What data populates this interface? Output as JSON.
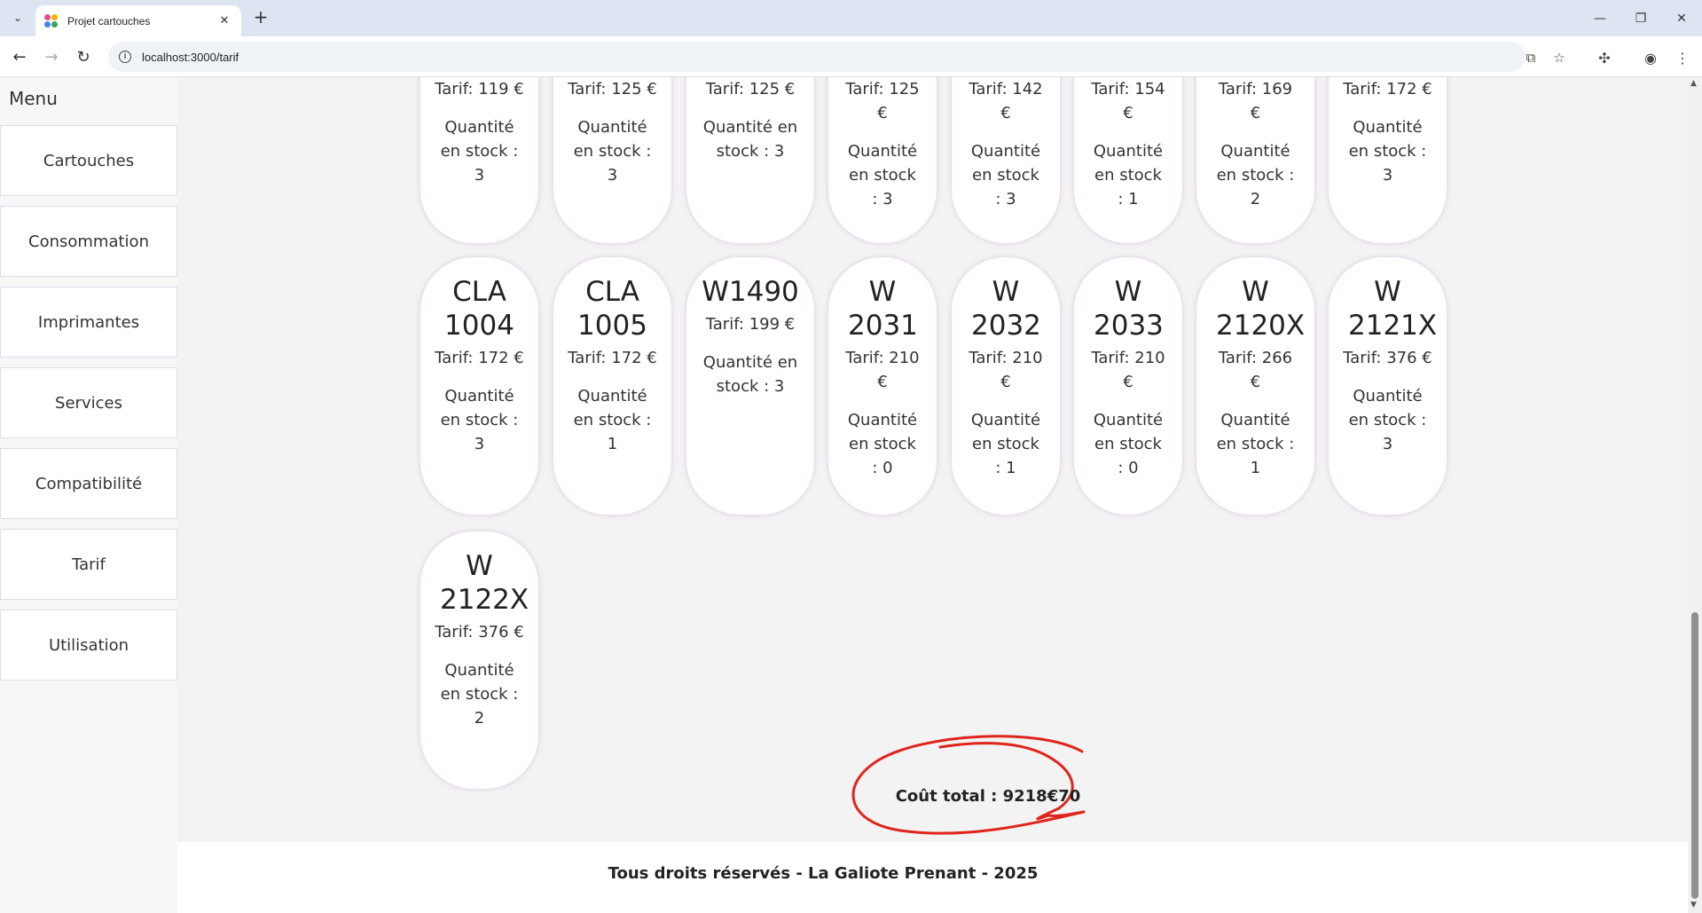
{
  "browser": {
    "tab_title": "Projet cartouches",
    "url": "localhost:3000/tarif",
    "favicon_colors": [
      "#e94b8a",
      "#f4b400",
      "#4285f4",
      "#34a853"
    ]
  },
  "sidebar": {
    "title": "Menu",
    "items": [
      {
        "label": "Cartouches"
      },
      {
        "label": "Consommation"
      },
      {
        "label": "Imprimantes"
      },
      {
        "label": "Services"
      },
      {
        "label": "Compatibilité"
      },
      {
        "label": "Tarif"
      },
      {
        "label": "Utilisation"
      }
    ]
  },
  "cards": [
    {
      "code": "",
      "price": "Tarif: 119 €",
      "stock": "Quantité en stock : 3"
    },
    {
      "code": "",
      "price": "Tarif: 125 €",
      "stock": "Quantité en stock : 3"
    },
    {
      "code": "",
      "price": "Tarif: 125 €",
      "stock": "Quantité en stock : 3"
    },
    {
      "code": "",
      "price": "Tarif: 125 €",
      "stock": "Quantité en stock : 3"
    },
    {
      "code": "",
      "price": "Tarif: 142 €",
      "stock": "Quantité en stock : 3"
    },
    {
      "code": "",
      "price": "Tarif: 154 €",
      "stock": "Quantité en stock : 1"
    },
    {
      "code": "",
      "price": "Tarif: 169 €",
      "stock": "Quantité en stock : 2"
    },
    {
      "code": "",
      "price": "Tarif: 172 €",
      "stock": "Quantité en stock : 3"
    },
    {
      "code": "CLA 1004",
      "price": "Tarif: 172 €",
      "stock": "Quantité en stock : 3"
    },
    {
      "code": "CLA 1005",
      "price": "Tarif: 172 €",
      "stock": "Quantité en stock : 1"
    },
    {
      "code": "W1490",
      "price": "Tarif: 199 €",
      "stock": "Quantité en stock : 3"
    },
    {
      "code": "W 2031",
      "price": "Tarif: 210 €",
      "stock": "Quantité en stock : 0"
    },
    {
      "code": "W 2032",
      "price": "Tarif: 210 €",
      "stock": "Quantité en stock : 1"
    },
    {
      "code": "W 2033",
      "price": "Tarif: 210 €",
      "stock": "Quantité en stock : 0"
    },
    {
      "code": "W 2120X",
      "price": "Tarif: 266 €",
      "stock": "Quantité en stock : 1"
    },
    {
      "code": "W 2121X",
      "price": "Tarif: 376 €",
      "stock": "Quantité en stock : 3"
    },
    {
      "code": "W 2122X",
      "price": "Tarif: 376 €",
      "stock": "Quantité en stock : 2"
    }
  ],
  "total": {
    "text": "Coût total : 9218€70",
    "annotation_color": "#e0241b"
  },
  "footer": {
    "text": "Tous droits réservés - La Galiote Prenant - 2025"
  }
}
